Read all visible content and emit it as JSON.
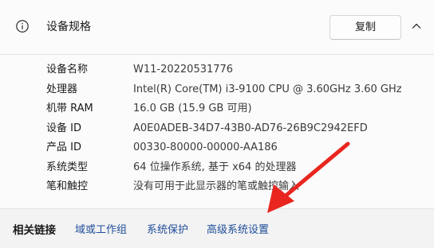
{
  "header": {
    "title": "设备规格",
    "copy_label": "复制",
    "info_icon": "info-icon",
    "collapse_icon": "chevron-up-icon"
  },
  "specs": [
    {
      "label": "设备名称",
      "value": "W11-20220531776"
    },
    {
      "label": "处理器",
      "value": "Intel(R) Core(TM) i3-9100 CPU @ 3.60GHz   3.60 GHz"
    },
    {
      "label": "机带 RAM",
      "value": "16.0 GB (15.9 GB 可用)"
    },
    {
      "label": "设备 ID",
      "value": "A0E0ADEB-34D7-43B0-AD76-26B9C2942EFD"
    },
    {
      "label": "产品 ID",
      "value": "00330-80000-00000-AA186"
    },
    {
      "label": "系统类型",
      "value": "64 位操作系统, 基于 x64 的处理器"
    },
    {
      "label": "笔和触控",
      "value": "没有可用于此显示器的笔或触控输入"
    }
  ],
  "related_links": {
    "title": "相关链接",
    "links": [
      "域或工作组",
      "系统保护",
      "高级系统设置"
    ]
  },
  "colors": {
    "link": "#1f4e9a",
    "annotation_arrow": "#e8261f"
  }
}
